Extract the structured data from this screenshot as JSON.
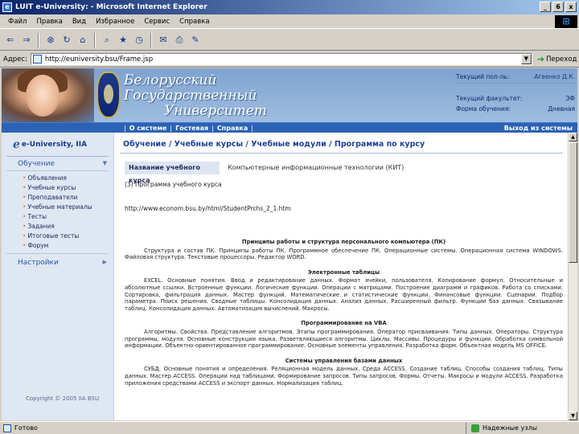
{
  "window": {
    "title": "LUIT e-University: - Microsoft Internet Explorer",
    "buttons": [
      "_",
      "6",
      "x"
    ]
  },
  "menubar": {
    "items": [
      "Файл",
      "Правка",
      "Вид",
      "Избранное",
      "Сервис",
      "Справка"
    ]
  },
  "toolbar": {
    "icons": [
      "back-icon",
      "forward-icon",
      "stop-icon",
      "refresh-icon",
      "home-icon",
      "search-icon",
      "favorites-icon",
      "history-icon",
      "mail-icon",
      "print-icon",
      "edit-icon"
    ]
  },
  "address": {
    "label": "Адрес:",
    "url": "http://euniversity.bsu/Frame.jsp",
    "go_label": "Переход"
  },
  "header": {
    "university_lines": [
      "Белорусский",
      "Государственный",
      "Университет"
    ],
    "user_label": "Текущий пол-ль:",
    "user_name": "Агеенко Д.К.",
    "faculty_label": "Текущий факультет:",
    "faculty_value": "ЭФ",
    "form_label": "Форма обучения:",
    "form_value": "Дневная"
  },
  "nav": {
    "links": [
      "О системе",
      "Гостевая",
      "Справка"
    ],
    "exit": "Выход из системы"
  },
  "sidebar": {
    "brand": "e-University, IIA",
    "section_training": "Обучение",
    "items": [
      "Объявления",
      "Учебные курсы",
      "Преподаватели",
      "Учебные материалы",
      "Тесты",
      "Задания",
      "Итоговые тесты",
      "Форум"
    ],
    "section_settings": "Настройки",
    "copyright": "Copyright © 2005 IIA BSU"
  },
  "main": {
    "breadcrumb": "Обучение / Учебные курсы / Учебные модули / Программа по курсу",
    "course_label": "Название учебного курса",
    "course_value": "Компьютерные информационные технологии (КИТ)",
    "program_label": "(3) Программа учебного курса",
    "program_url": "http://www.econom.bsu.by/html/StudentPrchs_2_1.htm",
    "sections": [
      {
        "heading": "Принципы работы и структура персонального компьютера (ПК)",
        "text": "Структура и состав ПК. Принципы работы ПК. Программное обеспечение ПК. Операционные системы. Операционная система WINDOWS. Файловая структура. Текстовые процессоры. Редактор WORD."
      },
      {
        "heading": "Электронные таблицы",
        "text": "EXCEL. Основные понятия. Ввод и редактирование данных. Формат ячейки, пользователя. Копирование формул. Относительные и абсолютные ссылки. Встроенные функции. Логические функции. Операции с матрицами. Построение диаграмм и графиков. Работа со списками. Сортировка, фильтрация данных. Мастер функций. Математические и статистические функции. Финансовые функции. Сценарии. Подбор параметра. Поиск решения. Сводные таблицы. Консолидация данных. Анализ данных. Расширенный фильтр. Функции баз данных. Связывание таблиц. Консолидация данных. Автоматизация вычислений. Макросы."
      },
      {
        "heading": "Программирование на VBA",
        "text": "Алгоритмы. Свойства. Представление алгоритмов. Этапы программирования. Оператор присваивания. Типы данных. Операторы. Структура программы, модуля. Основные конструкции языка. Разветвляющиеся алгоритмы. Циклы. Массивы. Процедуры и функции. Обработка символьной информации. Объектно-ориентированное программирование. Основные элементы управления. Разработка форм. Объектная модель MS OFFICE."
      },
      {
        "heading": "Системы управления базами данных",
        "text": "СУБД. Основные понятия и определения. Реляционная модель данных. Среда ACCESS. Создание таблиц. Способы создания таблиц. Типы данных. Мастер ACCESS. Операции над таблицами. Формирование запросов. Типы запросов. Формы. Отчеты. Макросы и модули ACCESS. Разработка приложения средствами ACCESS и экспорт данных. Нормализация таблиц."
      }
    ]
  },
  "status": {
    "left": "Готово",
    "zone": "Надежные узлы"
  }
}
